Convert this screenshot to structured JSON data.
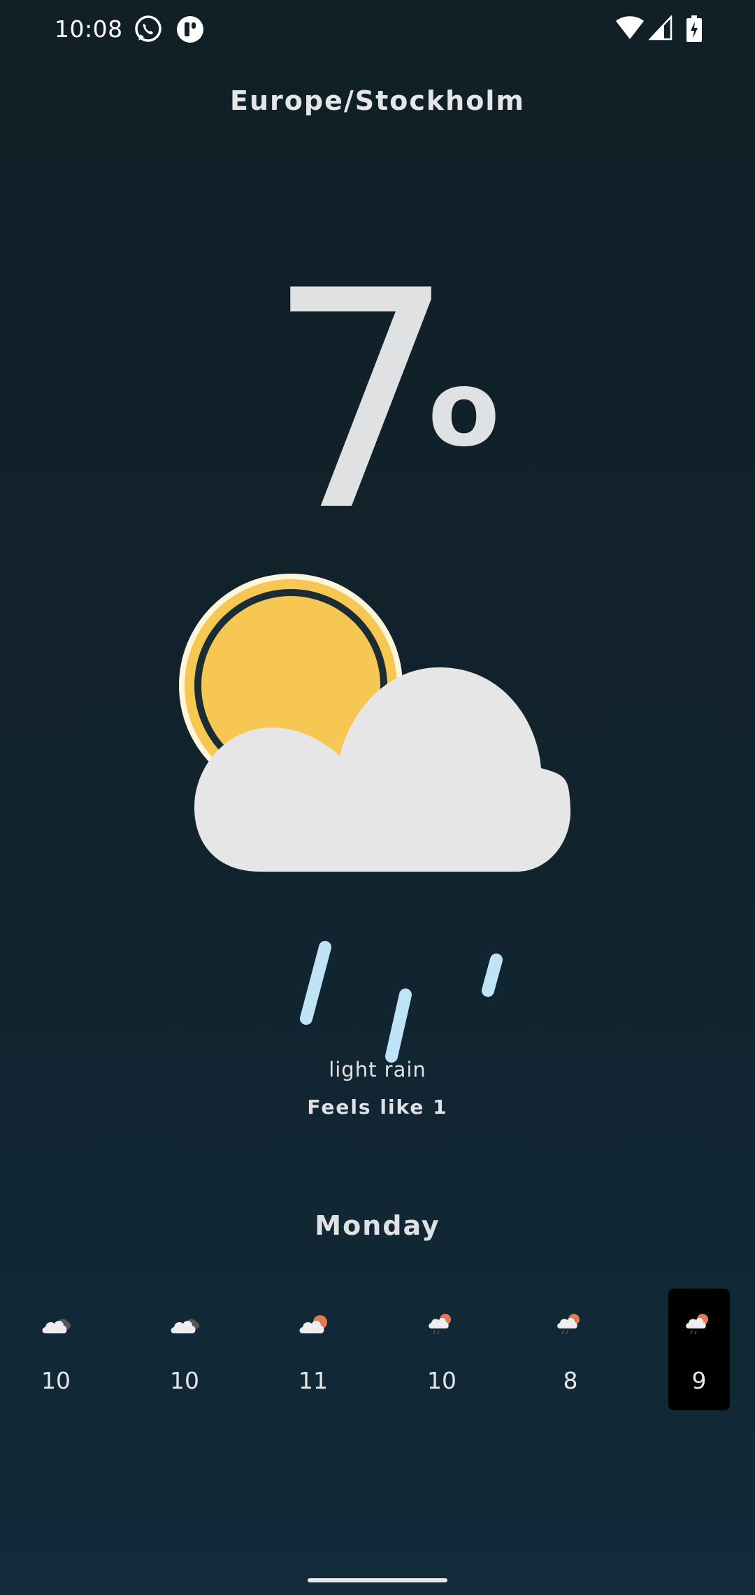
{
  "status_bar": {
    "time": "10:08",
    "left_icons": [
      "whatsapp-icon",
      "app-notification-icon"
    ],
    "right_icons": [
      "wifi-icon",
      "cellular-signal-icon",
      "battery-charging-icon"
    ]
  },
  "location": "Europe/Stockholm",
  "current": {
    "temperature": "7",
    "unit": "o",
    "condition": "light rain",
    "feels_like": "Feels like 1",
    "icon": "sun-cloud-rain-icon"
  },
  "day": "Monday",
  "forecast": [
    {
      "temp": "10",
      "icon": "cloudy-icon",
      "selected": false
    },
    {
      "temp": "10",
      "icon": "cloudy-icon",
      "selected": false
    },
    {
      "temp": "11",
      "icon": "cloud-sun-icon",
      "selected": false
    },
    {
      "temp": "10",
      "icon": "cloud-sun-rain-icon",
      "selected": false
    },
    {
      "temp": "8",
      "icon": "cloud-sun-rain-icon",
      "selected": false
    },
    {
      "temp": "9",
      "icon": "cloud-sun-rain-icon",
      "selected": true
    }
  ],
  "colors": {
    "background_top": "#111f26",
    "background_bottom": "#112b3a",
    "sun": "#f6c752",
    "cloud": "#e6e6e6",
    "rain": "#bfe4f8",
    "selected_bg": "#000000"
  }
}
